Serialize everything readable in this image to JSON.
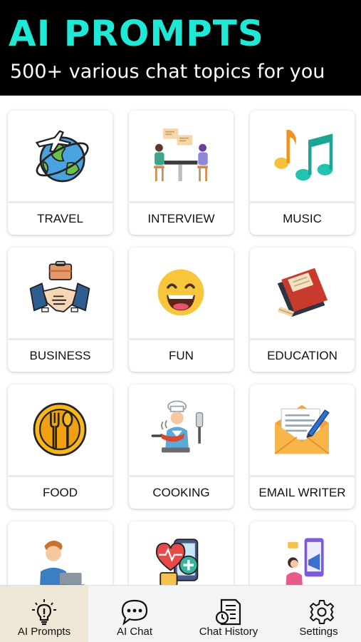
{
  "header": {
    "title": "AI PROMPTS",
    "subtitle": "500+ various chat topics for you"
  },
  "categories": [
    {
      "label": "TRAVEL",
      "icon": "travel-globe-airplane-icon"
    },
    {
      "label": "INTERVIEW",
      "icon": "interview-people-table-icon"
    },
    {
      "label": "MUSIC",
      "icon": "music-notes-icon"
    },
    {
      "label": "BUSINESS",
      "icon": "business-handshake-briefcase-icon"
    },
    {
      "label": "FUN",
      "icon": "fun-laughing-face-icon"
    },
    {
      "label": "EDUCATION",
      "icon": "education-books-icon"
    },
    {
      "label": "FOOD",
      "icon": "food-plate-fork-spoon-icon"
    },
    {
      "label": "COOKING",
      "icon": "cooking-chef-pan-icon"
    },
    {
      "label": "EMAIL WRITER",
      "icon": "email-envelope-pen-icon"
    }
  ],
  "partial_cards": [
    {
      "icon": "person-laptop-icon"
    },
    {
      "icon": "health-heart-phone-icon"
    },
    {
      "icon": "marketing-megaphone-phone-icon"
    }
  ],
  "tabs": [
    {
      "label": "AI Prompts",
      "icon": "lightbulb-idea-icon",
      "active": true
    },
    {
      "label": "AI Chat",
      "icon": "chat-bubble-icon",
      "active": false
    },
    {
      "label": "Chat History",
      "icon": "history-document-icon",
      "active": false
    },
    {
      "label": "Settings",
      "icon": "gear-icon",
      "active": false
    }
  ],
  "colors": {
    "header_bg": "#000000",
    "title_accent": "#1de9d6",
    "active_tab_bg": "#efe7d6"
  }
}
